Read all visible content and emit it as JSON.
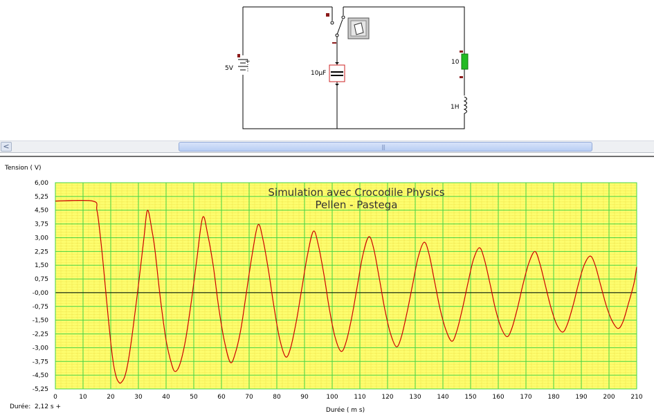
{
  "circuit": {
    "battery_label": "5V",
    "battery_plus": "+",
    "capacitor_label": "10µF",
    "resistor_label": "10",
    "inductor_label": "1H"
  },
  "scrollbar": {
    "left_arrow": "<",
    "grip": "|||"
  },
  "colors": {
    "plot_background": "#fdfd6e",
    "grid_major": "#44d344",
    "grid_minor": "#e0c020",
    "trace": "#cc0000",
    "resistor": "#22bb22",
    "capacitor_box": "#cc2222"
  },
  "icons": {
    "switch": "switch-icon"
  },
  "status": {
    "label": "Durée:",
    "value": "2,12 s +"
  },
  "chart_data": {
    "type": "line",
    "title": "Simulation avec Crocodile Physics",
    "subtitle": "Pellen - Pastega",
    "ylabel": "Tension ( V)",
    "xlabel": "Durée ( m s)",
    "xlim": [
      0,
      210
    ],
    "ylim": [
      -5.25,
      6.0
    ],
    "x_ticks": [
      "0",
      "10",
      "20",
      "30",
      "40",
      "50",
      "60",
      "70",
      "80",
      "90",
      "100",
      "110",
      "120",
      "130",
      "140",
      "150",
      "160",
      "170",
      "180",
      "190",
      "200",
      "210"
    ],
    "y_ticks": [
      "6,00",
      "5,25",
      "4,50",
      "3,75",
      "3,00",
      "2,25",
      "1,50",
      "0,75",
      "-0,00",
      "-0,75",
      "-1,50",
      "-2,25",
      "-3,00",
      "-3,75",
      "-4,50",
      "-5,25"
    ],
    "grid": true,
    "series": [
      {
        "x": [
          0,
          13.5,
          15,
          16,
          17,
          18,
          19,
          20,
          21,
          22,
          23,
          23.8,
          25,
          26,
          27,
          28,
          30,
          32,
          33.3,
          35,
          36,
          38,
          40,
          42,
          43.3,
          45,
          47,
          49,
          51,
          53.2,
          55,
          57,
          59,
          61,
          63.2,
          65,
          67,
          69,
          71,
          73.2,
          75,
          77,
          79,
          81,
          83.2,
          85,
          87,
          89,
          91,
          93.2,
          95,
          97,
          99,
          101,
          103.2,
          105,
          107,
          109,
          111,
          113.2,
          115,
          117,
          119,
          121,
          123.2,
          125,
          127,
          129,
          131,
          133.2,
          135,
          137,
          139,
          141,
          143.2,
          145,
          147,
          149,
          151,
          153.2,
          155,
          157,
          159,
          161,
          163.2,
          165,
          167,
          169,
          171,
          173.2,
          175,
          177,
          179,
          181,
          183.2,
          185,
          187,
          189,
          191,
          193.2,
          195,
          197,
          199,
          201,
          203.2,
          205,
          207,
          209,
          210
        ],
        "y": [
          5.0,
          5.0,
          4.5,
          3.4,
          2.0,
          0.4,
          -1.2,
          -2.7,
          -3.9,
          -4.6,
          -4.9,
          -4.9,
          -4.6,
          -4.0,
          -3.1,
          -2.0,
          0.4,
          3.0,
          4.5,
          3.3,
          2.3,
          -0.4,
          -2.6,
          -3.9,
          -4.3,
          -3.9,
          -2.6,
          -0.6,
          1.7,
          4.1,
          3.2,
          1.5,
          -0.8,
          -2.6,
          -3.8,
          -3.3,
          -2.0,
          0.0,
          2.0,
          3.7,
          2.9,
          1.2,
          -0.8,
          -2.5,
          -3.5,
          -3.0,
          -1.6,
          0.2,
          2.0,
          3.35,
          2.6,
          1.0,
          -0.9,
          -2.4,
          -3.2,
          -2.7,
          -1.4,
          0.3,
          2.0,
          3.05,
          2.4,
          0.8,
          -0.9,
          -2.2,
          -2.95,
          -2.4,
          -1.1,
          0.4,
          1.9,
          2.75,
          2.1,
          0.6,
          -0.9,
          -2.0,
          -2.65,
          -2.1,
          -0.9,
          0.5,
          1.8,
          2.45,
          1.8,
          0.5,
          -0.9,
          -1.9,
          -2.4,
          -1.9,
          -0.8,
          0.5,
          1.6,
          2.25,
          1.6,
          0.4,
          -0.8,
          -1.7,
          -2.15,
          -1.7,
          -0.7,
          0.5,
          1.5,
          2.0,
          1.5,
          0.4,
          -0.7,
          -1.5,
          -1.95,
          -1.6,
          -0.6,
          0.5,
          1.4
        ]
      }
    ]
  }
}
